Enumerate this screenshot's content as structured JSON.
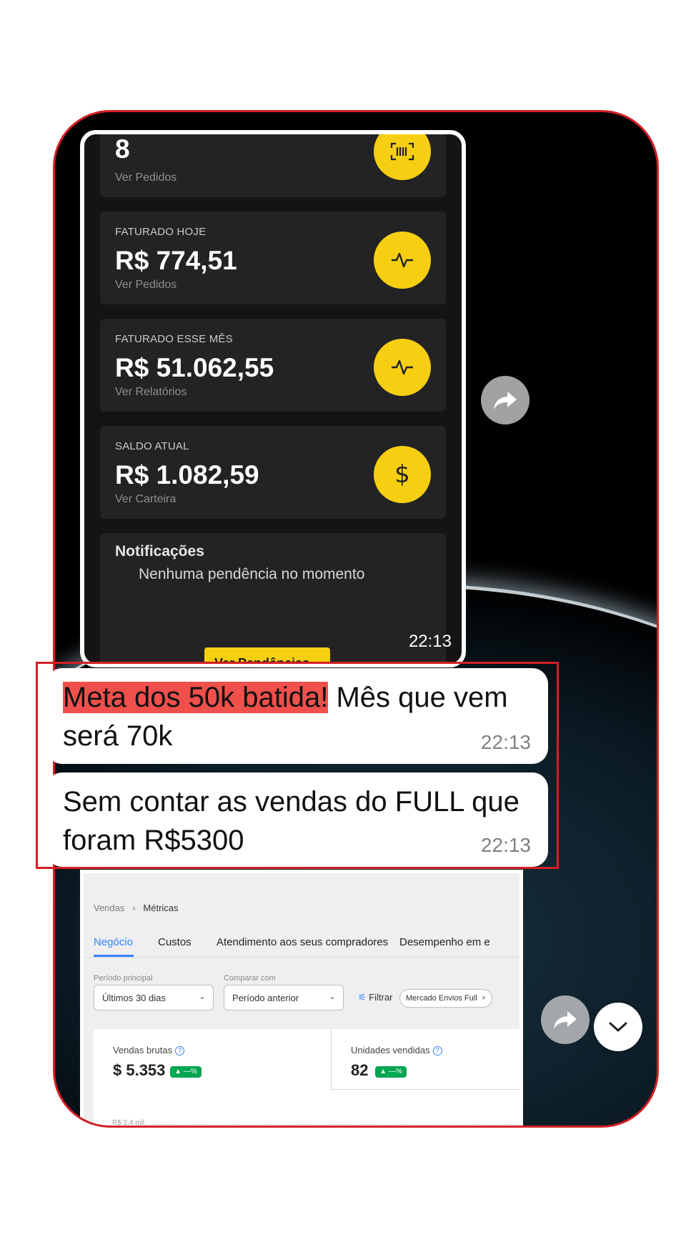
{
  "shot": {
    "cards": [
      {
        "label": "",
        "value": "8",
        "link": "Ver Pedidos",
        "icon": "barcode-icon"
      },
      {
        "label": "FATURADO HOJE",
        "value": "R$ 774,51",
        "link": "Ver Pedidos",
        "icon": "activity-icon"
      },
      {
        "label": "FATURADO ESSE MÊS",
        "value": "R$ 51.062,55",
        "link": "Ver Relatórios",
        "icon": "activity-icon"
      },
      {
        "label": "SALDO ATUAL",
        "value": "R$ 1.082,59",
        "link": "Ver Carteira",
        "icon": "dollar-icon"
      }
    ],
    "notifications": {
      "title": "Notificações",
      "text": "Nenhuma pendência no momento"
    },
    "button_label": "Ver Pendências",
    "time": "22:13"
  },
  "messages": [
    {
      "highlight": "Meta dos 50k batida!",
      "text": " Mês que vem será 70k",
      "time": "22:13"
    },
    {
      "highlight": "",
      "text": "Sem contar as vendas do FULL que foram R$5300",
      "time": "22:13"
    }
  ],
  "metrics": {
    "breadcrumb": {
      "parent": "Vendas",
      "current": "Métricas"
    },
    "tabs": [
      "Negócio",
      "Custos",
      "Atendimento aos seus compradores",
      "Desempenho em e"
    ],
    "periodo_label": "Período principal",
    "periodo_value": "Últimos 30 dias",
    "comparar_label": "Comparar com",
    "comparar_value": "Período anterior",
    "filter_label": "Filtrar",
    "chip": "Mercado Envios Full",
    "kpis": [
      {
        "label": "Vendas brutas",
        "value": "$ 5.353",
        "badge": "▲ —%"
      },
      {
        "label": "Unidades vendidas",
        "value": "82",
        "badge": "▲ —%"
      }
    ],
    "axis_label": "R$ 2,4 mil"
  },
  "colors": {
    "accent_yellow": "#f6cf12",
    "highlight_red": "#f0504b",
    "frame_red": "#d41f25",
    "ml_blue": "#3483fa",
    "badge_green": "#00a650"
  }
}
